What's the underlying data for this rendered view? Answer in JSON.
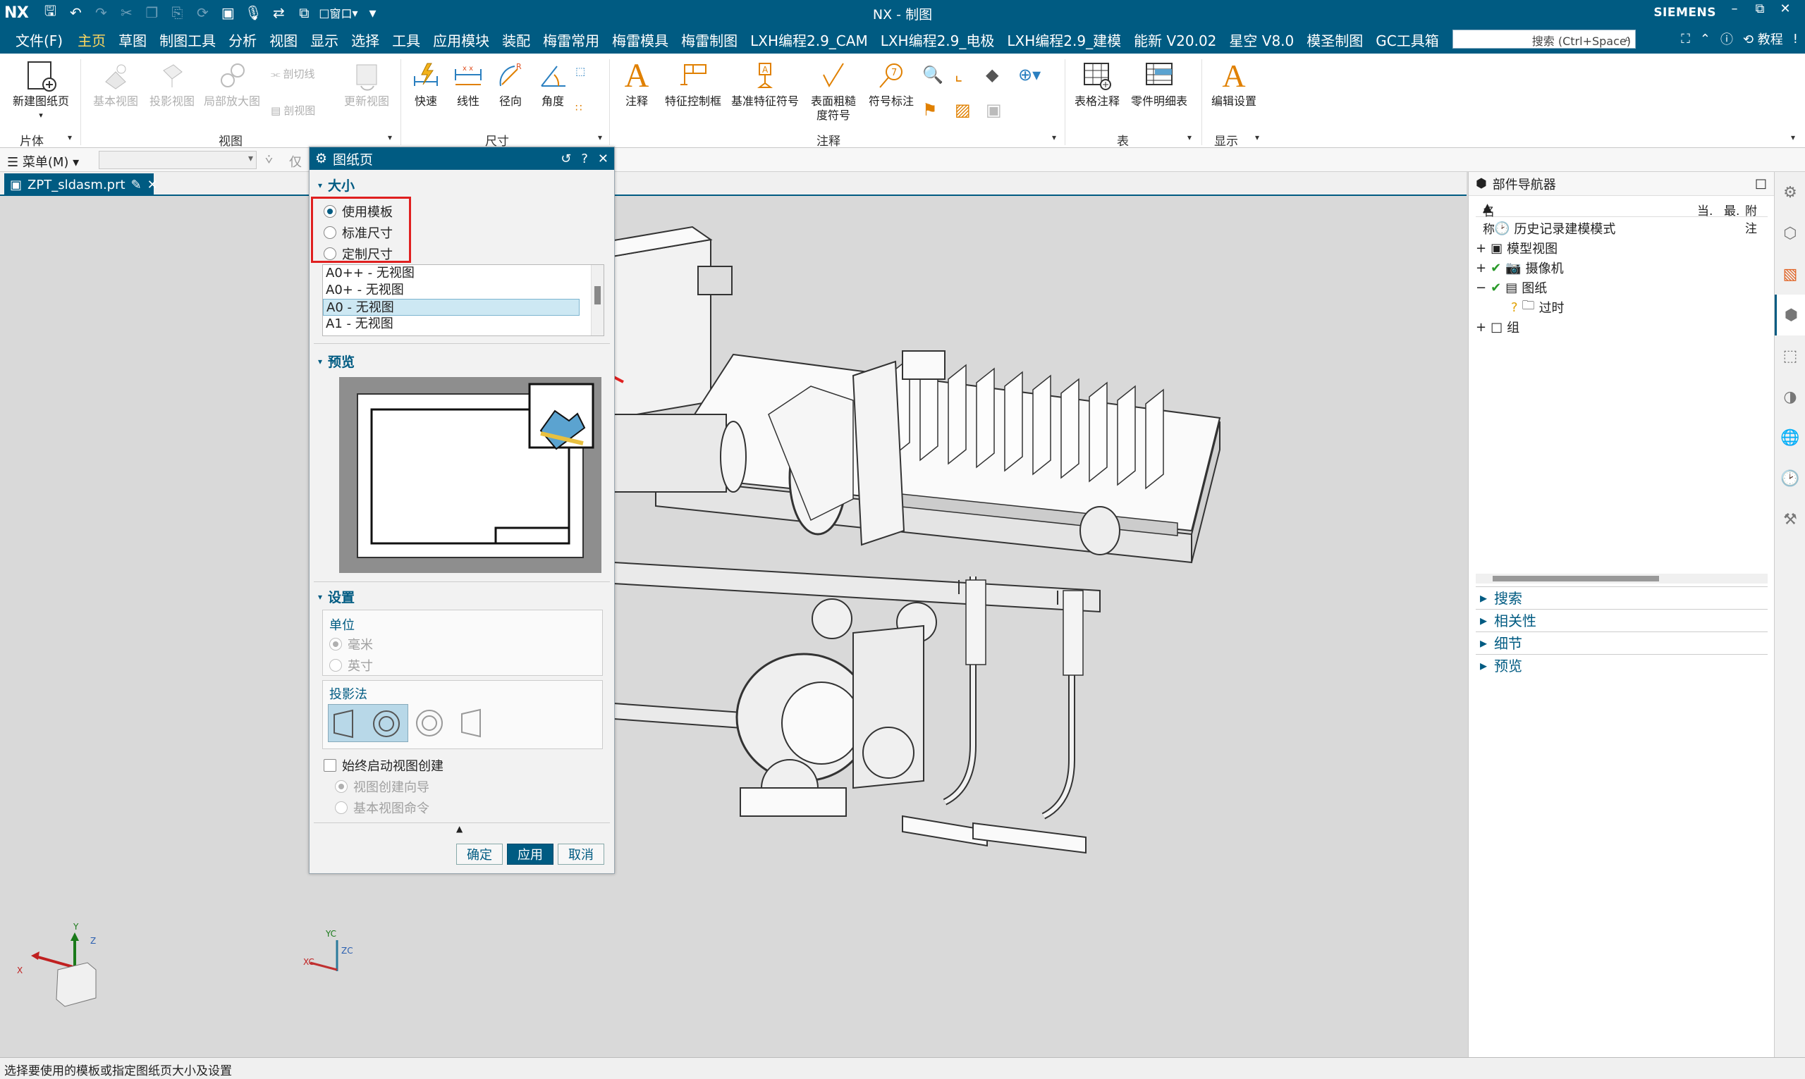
{
  "app": {
    "logo": "NX",
    "title": "NX - 制图",
    "brand": "SIEMENS",
    "help": "教程"
  },
  "menu": {
    "file": "文件(F)",
    "items": [
      "主页",
      "草图",
      "制图工具",
      "分析",
      "视图",
      "显示",
      "选择",
      "工具",
      "应用模块",
      "装配",
      "梅雷常用",
      "梅雷模具",
      "梅雷制图",
      "LXH编程2.9_CAM",
      "LXH编程2.9_电极",
      "LXH编程2.9_建模",
      "能新 V20.02",
      "星空 V8.0",
      "模圣制图",
      "GC工具箱"
    ],
    "search_placeholder": "搜索 (Ctrl+Space)"
  },
  "qat": {
    "window": "窗口"
  },
  "ribbon": {
    "new_sheet": "新建图纸页",
    "base_view": "基本视图",
    "proj_view": "投影视图",
    "detail_view": "局部放大图",
    "section_line": "剖切线",
    "section_view": "剖视图",
    "update_view": "更新视图",
    "quick": "快速",
    "linear": "线性",
    "radial": "径向",
    "angle": "角度",
    "note": "注释",
    "fcf": "特征控制框",
    "datum": "基准特征符号",
    "surface": "表面粗糙\n度符号",
    "balloon": "符号标注",
    "table_note": "表格注释",
    "parts_list": "零件明细表",
    "edit_settings": "编辑设置",
    "groups": {
      "sheet": "片体",
      "view": "视图",
      "dim": "尺寸",
      "annotation": "注释",
      "table": "表",
      "display": "显示"
    }
  },
  "cmdbar": {
    "menu": "菜单(M)",
    "only": "仅"
  },
  "doc_tab": {
    "filename": "ZPT_sldasm.prt"
  },
  "dialog": {
    "title": "图纸页",
    "size_section": "大小",
    "size_options": [
      "使用模板",
      "标准尺寸",
      "定制尺寸"
    ],
    "size_selected": 0,
    "templates": [
      "A0++ - 无视图",
      "A0+ - 无视图",
      "A0 - 无视图",
      "A1 - 无视图"
    ],
    "template_selected": 2,
    "preview_section": "预览",
    "settings_section": "设置",
    "units_label": "单位",
    "units": [
      "毫米",
      "英寸"
    ],
    "projection_label": "投影法",
    "always_start": "始终启动视图创建",
    "view_wizard": "视图创建向导",
    "base_view_cmd": "基本视图命令",
    "ok": "确定",
    "apply": "应用",
    "cancel": "取消"
  },
  "navigator": {
    "title": "部件导航器",
    "col_name": "名称",
    "col_cur": "当.",
    "col_latest": "最.",
    "col_attach": "附注",
    "tree": [
      "历史记录建模模式",
      "模型视图",
      "摄像机",
      "图纸",
      "过时",
      "组"
    ],
    "accordion": [
      "搜索",
      "相关性",
      "细节",
      "预览"
    ]
  },
  "triads": {
    "x": "X",
    "y": "Y",
    "z": "Z",
    "xc": "XC",
    "yc": "YC",
    "zc": "ZC"
  },
  "status": "选择要使用的模板或指定图纸页大小及设置",
  "colors": {
    "titlebar": "#005b82",
    "active_menu": "#ffd75e",
    "annotation": "#e02020"
  }
}
